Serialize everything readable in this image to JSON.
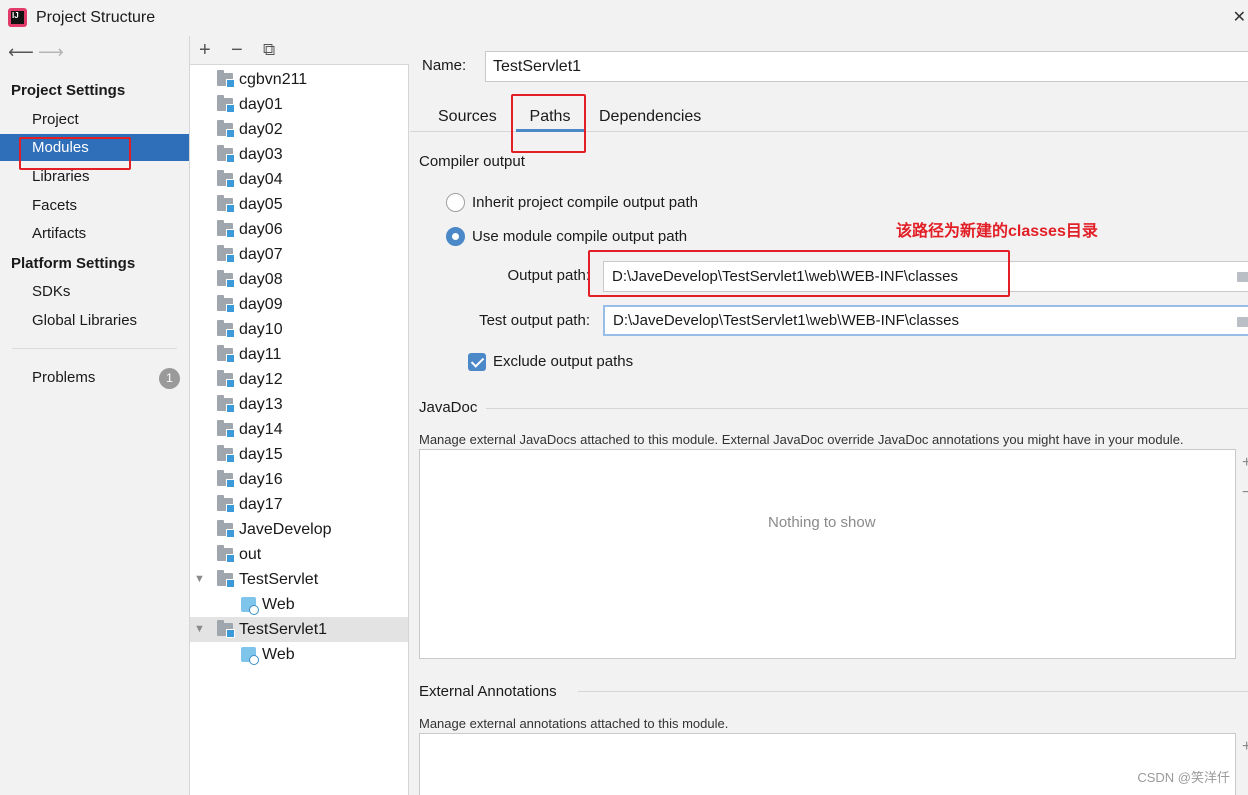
{
  "window": {
    "title": "Project Structure"
  },
  "nav": {
    "project_settings_header": "Project Settings",
    "platform_settings_header": "Platform Settings",
    "items": {
      "project": "Project",
      "modules": "Modules",
      "libraries": "Libraries",
      "facets": "Facets",
      "artifacts": "Artifacts",
      "sdks": "SDKs",
      "global_libraries": "Global Libraries",
      "problems": "Problems"
    },
    "problems_count": "1",
    "selected": "Modules"
  },
  "tree": {
    "toolbar": {
      "add": "+",
      "remove": "−",
      "copy": "⧉"
    },
    "modules": [
      "cgbvn211",
      "day01",
      "day02",
      "day03",
      "day04",
      "day05",
      "day06",
      "day07",
      "day08",
      "day09",
      "day10",
      "day11",
      "day12",
      "day13",
      "day14",
      "day15",
      "day16",
      "day17",
      "JaveDevelop",
      "out"
    ],
    "testservlet": {
      "label": "TestServlet",
      "child": "Web"
    },
    "testservlet1": {
      "label": "TestServlet1",
      "child": "Web"
    }
  },
  "detail": {
    "name_label": "Name:",
    "name_value": "TestServlet1",
    "tabs": {
      "sources": "Sources",
      "paths": "Paths",
      "dependencies": "Dependencies"
    },
    "active_tab": "Paths",
    "compiler_output": {
      "title": "Compiler output",
      "inherit_label": "Inherit project compile output path",
      "use_module_label": "Use module compile output path",
      "selected": "use_module",
      "output_path_label": "Output path:",
      "output_path_value": "D:\\JaveDevelop\\TestServlet1\\web\\WEB-INF\\classes",
      "test_output_path_label": "Test output path:",
      "test_output_path_value": "D:\\JaveDevelop\\TestServlet1\\web\\WEB-INF\\classes",
      "exclude_label": "Exclude output paths",
      "exclude_checked": true
    },
    "annotation": "该路径为新建的classes目录",
    "javadoc": {
      "title": "JavaDoc",
      "description": "Manage external JavaDocs attached to this module. External JavaDoc override JavaDoc annotations you might have in your module.",
      "empty_text": "Nothing to show"
    },
    "external_annotations": {
      "title": "External Annotations",
      "description": "Manage external annotations attached to this module."
    }
  },
  "watermark": "CSDN @笑洋仟",
  "colors": {
    "selection": "#2f6eb8",
    "accent": "#4a88c7",
    "highlight_box": "#e21f26"
  }
}
